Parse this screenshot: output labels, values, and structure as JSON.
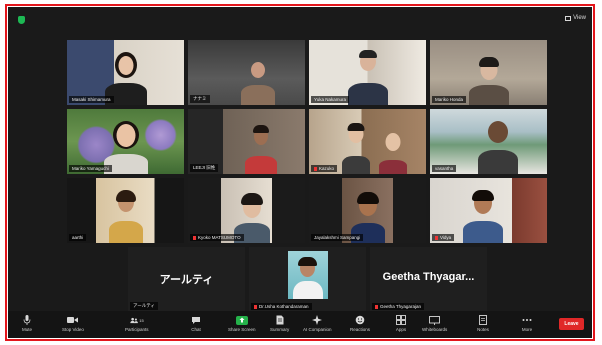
{
  "window": {
    "view_label": "View",
    "accent": "#e3161c"
  },
  "participants": [
    {
      "name": "Masaki Shimamura",
      "muted": false
    },
    {
      "name": "ナナミ",
      "muted": false
    },
    {
      "name": "Yuka Nakamura",
      "muted": false
    },
    {
      "name": "Mariko Honda",
      "muted": false
    },
    {
      "name": "Mariko Yamaguchi",
      "muted": false
    },
    {
      "name": "LEEJI 旧姓",
      "muted": false
    },
    {
      "name": "Kazuko",
      "muted": true
    },
    {
      "name": "vasantha",
      "muted": false
    },
    {
      "name": "aarthi",
      "muted": false
    },
    {
      "name": "Kyoko MATSUMOTO",
      "muted": true
    },
    {
      "name": "Jayalakshmi Sampangi",
      "muted": false
    },
    {
      "name": "Vidya",
      "muted": true
    },
    {
      "name": "アールティ",
      "muted": false,
      "big_name": "アールティ"
    },
    {
      "name": "Dr.Usha Kothandaraman",
      "muted": true
    },
    {
      "name": "Geetha Thyagarajan",
      "muted": true,
      "big_name": "Geetha  Thyagar..."
    }
  ],
  "toolbar": {
    "items": [
      {
        "label": "Mute",
        "icon": "microphone-icon"
      },
      {
        "label": "Stop Video",
        "icon": "video-camera-icon"
      },
      {
        "label": "Participants",
        "icon": "participants-icon",
        "badge": "15"
      },
      {
        "label": "Chat",
        "icon": "chat-icon"
      },
      {
        "label": "Share Screen",
        "icon": "share-screen-icon"
      },
      {
        "label": "Summary",
        "icon": "summary-icon"
      },
      {
        "label": "AI Companion",
        "icon": "ai-companion-icon"
      },
      {
        "label": "Reactions",
        "icon": "reactions-icon"
      },
      {
        "label": "Apps",
        "icon": "apps-icon"
      },
      {
        "label": "Whiteboards",
        "icon": "whiteboard-icon"
      },
      {
        "label": "Notes",
        "icon": "notes-icon"
      },
      {
        "label": "More",
        "icon": "more-icon"
      }
    ],
    "leave_label": "Leave"
  }
}
